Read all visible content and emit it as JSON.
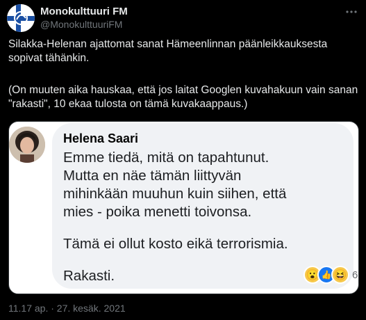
{
  "tweet": {
    "author_name": "Monokulttuuri FM",
    "author_handle": "@MonokulttuuriFM",
    "paragraph1_line1": "Silakka-Helenan ajattomat sanat Hämeenlinnan päänleikkauksesta",
    "paragraph1_line2": "sopivat tähänkin.",
    "paragraph2_line1": "(On muuten aika hauskaa, että jos laitat Googlen kuvahakuun vain sanan",
    "paragraph2_line2": "\"rakasti\", 10 ekaa tulosta on tämä kuvakaappaus.)",
    "timestamp": "11.17 ap. · 27. kesäk. 2021"
  },
  "embedded_post": {
    "name": "Helena Saari",
    "lines": [
      "Emme tiedä, mitä on tapahtunut.",
      "Mutta en näe tämän liittyvän",
      "mihinkään muuhun kuin siihen, että",
      "mies - poika menetti toivonsa.",
      "Tämä ei ollut kosto eikä terrorismia.",
      "Rakasti."
    ],
    "reaction_count": "6",
    "reactions": [
      "wow-icon",
      "like-icon",
      "haha-icon"
    ]
  },
  "colors": {
    "background": "#000000",
    "text": "#e7e9ea",
    "secondary": "#71767b",
    "bubble": "#f0f2f5",
    "like_blue": "#1877f2"
  }
}
